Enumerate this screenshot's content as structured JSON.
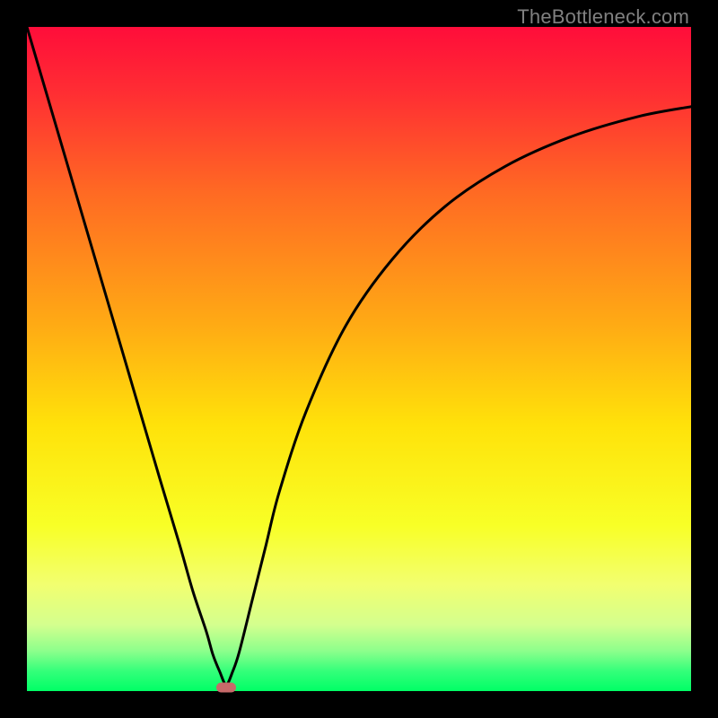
{
  "watermark": "TheBottleneck.com",
  "chart_data": {
    "type": "line",
    "title": "",
    "xlabel": "",
    "ylabel": "",
    "xlim": [
      0,
      100
    ],
    "ylim": [
      0,
      100
    ],
    "grid": false,
    "legend": false,
    "gradient_stops": [
      {
        "pct": 0,
        "color": "#ff0d3a"
      },
      {
        "pct": 10,
        "color": "#ff2e33"
      },
      {
        "pct": 25,
        "color": "#ff6a23"
      },
      {
        "pct": 45,
        "color": "#ffab14"
      },
      {
        "pct": 60,
        "color": "#ffe20a"
      },
      {
        "pct": 75,
        "color": "#f8ff26"
      },
      {
        "pct": 84,
        "color": "#f2ff70"
      },
      {
        "pct": 90,
        "color": "#d4ff8e"
      },
      {
        "pct": 94,
        "color": "#8cff8c"
      },
      {
        "pct": 97,
        "color": "#34ff7a"
      },
      {
        "pct": 100,
        "color": "#00ff66"
      }
    ],
    "series": [
      {
        "name": "bottleneck-curve",
        "x": [
          0,
          5,
          10,
          15,
          20,
          23,
          25,
          27,
          28,
          29,
          30,
          31,
          32,
          34,
          36,
          38,
          42,
          48,
          55,
          63,
          72,
          82,
          92,
          100
        ],
        "y": [
          100,
          83,
          66,
          49,
          32,
          22,
          15,
          9,
          5.5,
          3,
          1,
          3,
          6,
          14,
          22,
          30,
          42,
          55,
          65,
          73,
          79,
          83.5,
          86.5,
          88
        ]
      }
    ],
    "marker": {
      "x": 30,
      "y": 0.5,
      "color": "#c76a6a"
    }
  }
}
